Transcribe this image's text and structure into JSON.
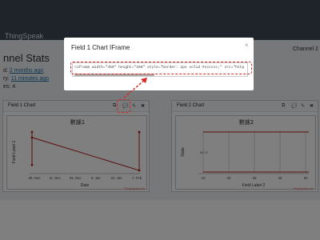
{
  "app": {
    "logo": "ThingSpeak",
    "channel_title": "nnel Stats",
    "channel2_link": "Channel 2",
    "meta": [
      {
        "label": "d:",
        "value": "2 months ago"
      },
      {
        "label": "ry:",
        "value": "11 minutes ago"
      },
      {
        "label": "es:",
        "value": "4"
      }
    ]
  },
  "modal": {
    "title": "Field 1 Chart IFrame",
    "close": "×",
    "code": "<iframe width=\"450\" height=\"260\" style=\"border: 1px solid #cccccc;\" src=\"http"
  },
  "panels": [
    {
      "title": "Field 1 Chart",
      "icons": [
        "external-link-icon",
        "comment-icon",
        "pencil-icon",
        "close-icon"
      ],
      "glyphs": [
        "⧉",
        "💬",
        "✎",
        "✖"
      ]
    },
    {
      "title": "Field 2 Chart",
      "icons": [
        "external-link-icon",
        "comment-icon",
        "pencil-icon",
        "close-icon"
      ],
      "glyphs": [
        "⧉",
        "💬",
        "✎",
        "✖"
      ]
    }
  ],
  "chart_data": [
    {
      "type": "line",
      "title": "數據1",
      "xlabel": "Date",
      "ylabel": "Field Label 1",
      "x_ticks": [
        "29. Nov",
        "11. Dec",
        "25. Dec",
        "8. Jan",
        "22. Jan",
        "7. Feb"
      ],
      "series": [
        {
          "values": [
            {
              "x": "29. Nov",
              "y": 7
            },
            {
              "x": "29. Nov",
              "y": 1
            },
            {
              "x": "29. Nov",
              "y": 6
            },
            {
              "x": "7. Feb",
              "y": 0
            },
            {
              "x": "7. Feb",
              "y": 7
            }
          ]
        }
      ],
      "color": "#b22222",
      "credit": "ThingSpeak.com"
    },
    {
      "type": "line",
      "title": "數據2",
      "xlabel": "Field Label 2",
      "ylabel": "State",
      "x_ticks": [
        "10",
        "20",
        "30",
        "40",
        "50"
      ],
      "y_annotation": "84:72",
      "series": [
        {
          "values": [
            {
              "x": 0,
              "y": 1
            },
            {
              "x": 55,
              "y": 1
            }
          ]
        },
        {
          "values": [
            {
              "x": 0,
              "y": 0
            },
            {
              "x": 55,
              "y": 0
            }
          ]
        }
      ],
      "color": "#b22222",
      "credit": "ThingSpeak.com"
    }
  ]
}
